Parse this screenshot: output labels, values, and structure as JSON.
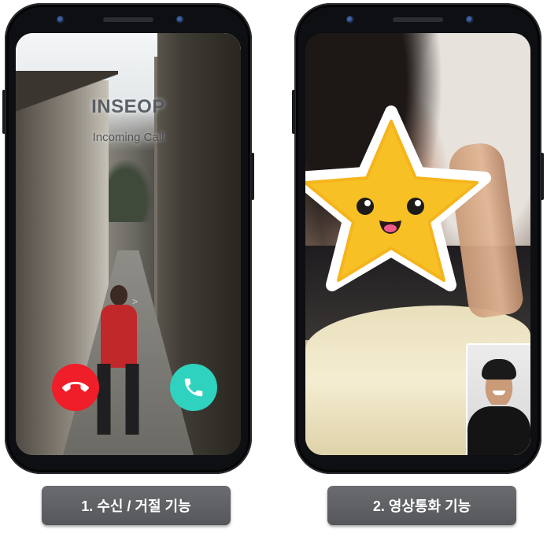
{
  "incoming_call": {
    "caller_name": "INSEOP",
    "status": "Incoming Call",
    "decline_icon": "phone-hangup-icon",
    "accept_icon": "phone-icon",
    "decline_color": "#f01e28",
    "accept_color": "#2fd2bf"
  },
  "video_call": {
    "sticker": "smiling-star-sticker",
    "sticker_color": "#f7c126",
    "self_view": "self-view-thumbnail"
  },
  "captions": {
    "left": "1. 수신 / 거절 기능",
    "right": "2. 영상통화 기능"
  }
}
